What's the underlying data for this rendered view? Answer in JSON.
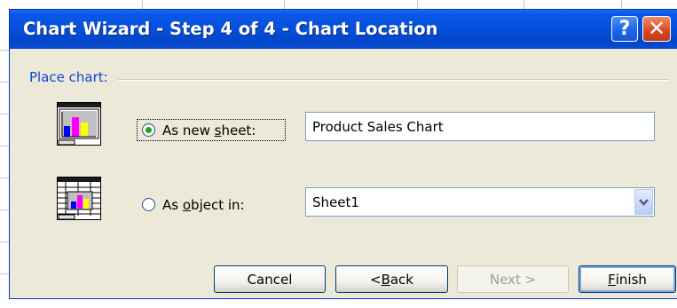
{
  "dialog": {
    "title": "Chart Wizard - Step 4 of 4 - Chart Location",
    "help_label": "?",
    "close_label": "✕"
  },
  "group": {
    "label": "Place chart:"
  },
  "options": {
    "new_sheet": {
      "label_before": "As new ",
      "label_accel": "s",
      "label_after": "heet:",
      "selected": true,
      "value": "Product Sales Chart"
    },
    "object_in": {
      "label_before": "As ",
      "label_accel": "o",
      "label_after": "bject in:",
      "selected": false,
      "value": "Sheet1"
    }
  },
  "buttons": {
    "cancel": "Cancel",
    "back_prefix": "< ",
    "back_accel": "B",
    "back_rest": "ack",
    "next": "Next >",
    "finish_accel": "F",
    "finish_rest": "inish"
  },
  "colors": {
    "titlebar": "#0a4ed4",
    "group_label": "#1046d8",
    "bar_yellow": "#ffff00",
    "bar_magenta": "#ff00ff",
    "bar_blue": "#0000ff"
  }
}
